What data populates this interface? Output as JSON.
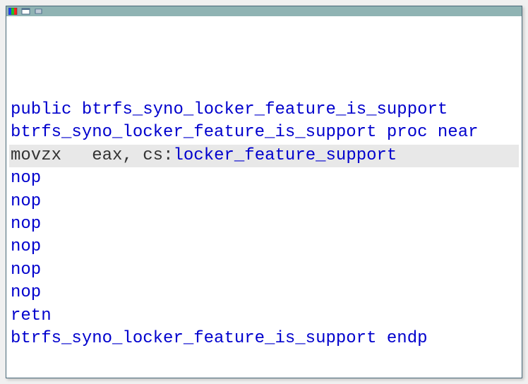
{
  "code": {
    "line1_kw": "public",
    "line1_sym": "btrfs_syno_locker_feature_is_support",
    "line2_sym": "btrfs_syno_locker_feature_is_support",
    "line2_kw1": "proc",
    "line2_kw2": "near",
    "line3_mnem": "movzx",
    "line3_reg": "eax",
    "line3_punct": ", ",
    "line3_seg": "cs",
    "line3_colon": ":",
    "line3_sym": "locker_feature_support",
    "nop1": "nop",
    "nop2": "nop",
    "nop3": "nop",
    "nop4": "nop",
    "nop5": "nop",
    "nop6": "nop",
    "retn": "retn",
    "line11_sym": "btrfs_syno_locker_feature_is_support",
    "line11_kw": "endp"
  }
}
